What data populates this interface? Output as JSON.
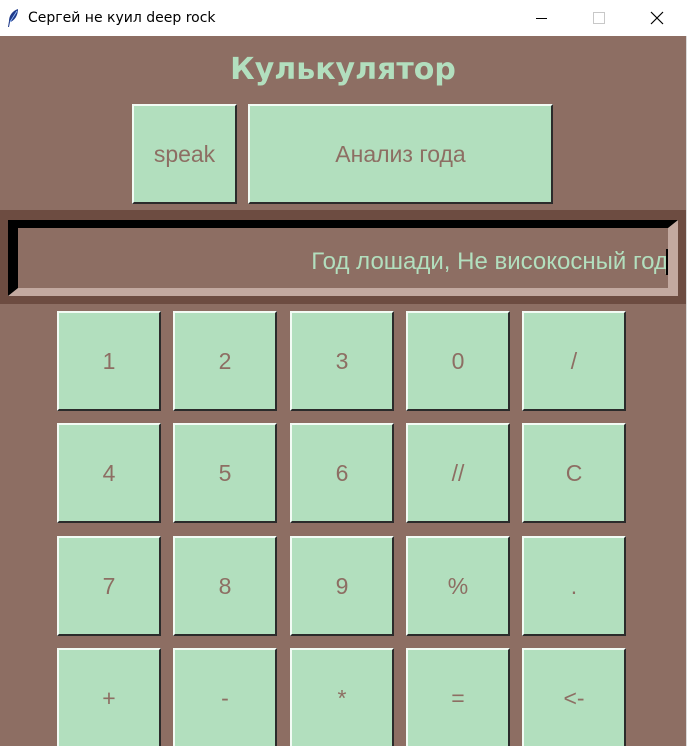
{
  "window": {
    "title": "Сергей не куил deep rock",
    "icon": "feather-icon",
    "controls": [
      "minimize-icon",
      "maximize-icon",
      "close-icon"
    ]
  },
  "app": {
    "heading": "Кулькулятор",
    "colors": {
      "background": "#8d6e63",
      "button": "#b2dfbe",
      "button_text": "#8d6e63",
      "heading": "#b2dfbe",
      "display_text": "#b2dfbe"
    },
    "top_buttons": {
      "speak": "speak",
      "year_analysis": "Анализ года"
    },
    "display": {
      "value": "Год лошади, Не високосный год"
    },
    "keypad": [
      [
        "1",
        "2",
        "3",
        "0",
        "/"
      ],
      [
        "4",
        "5",
        "6",
        "//",
        "C"
      ],
      [
        "7",
        "8",
        "9",
        "%",
        "."
      ],
      [
        "+",
        "-",
        "*",
        "=",
        "<-"
      ]
    ]
  }
}
